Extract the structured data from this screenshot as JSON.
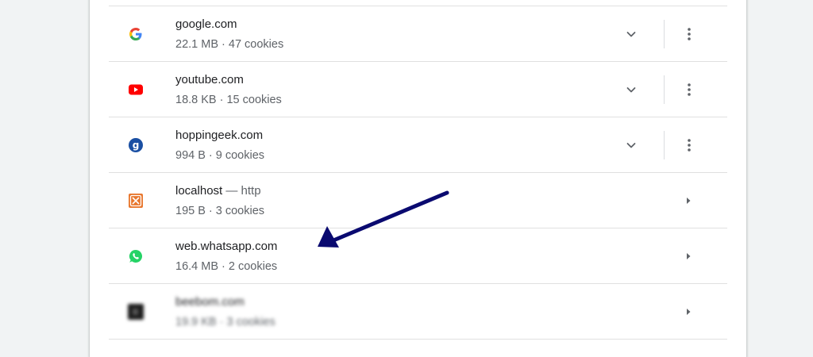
{
  "colors": {
    "annotation_arrow": "#0a0a70",
    "text_primary": "#202124",
    "text_secondary": "#5f6368",
    "divider": "#e0e0e0",
    "page_background": "#f1f3f4"
  },
  "sites": [
    {
      "name": "google.com",
      "suffix": "",
      "meta": "22.1 MB · 47 cookies",
      "icon": "google-icon",
      "control": "expand"
    },
    {
      "name": "youtube.com",
      "suffix": "",
      "meta": "18.8 KB · 15 cookies",
      "icon": "youtube-icon",
      "control": "expand"
    },
    {
      "name": "hoppingeek.com",
      "suffix": "",
      "meta": "994 B · 9 cookies",
      "icon": "hoppingeek-icon",
      "control": "expand"
    },
    {
      "name": "localhost",
      "suffix": " — http",
      "meta": "195 B · 3 cookies",
      "icon": "xampp-icon",
      "control": "arrow"
    },
    {
      "name": "web.whatsapp.com",
      "suffix": "",
      "meta": "16.4 MB · 2 cookies",
      "icon": "whatsapp-icon",
      "control": "arrow"
    },
    {
      "name": "beebom.com",
      "suffix": "",
      "meta": "19.9 KB · 3 cookies",
      "icon": "beebom-icon",
      "control": "arrow",
      "blurred": true
    }
  ]
}
